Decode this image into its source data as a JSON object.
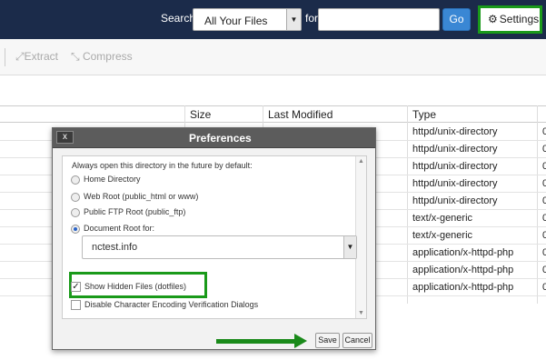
{
  "topbar": {
    "search_label": "Search",
    "search_scope": "All Your Files",
    "for_label": "for",
    "search_value": "",
    "go_label": "Go",
    "settings_label": "Settings"
  },
  "toolbar": {
    "extract_label": "Extract",
    "compress_label": "Compress"
  },
  "table": {
    "headers": {
      "size": "Size",
      "last_modified": "Last Modified",
      "type": "Type"
    },
    "rows": [
      {
        "type": "httpd/unix-directory",
        "perm": "0"
      },
      {
        "type": "httpd/unix-directory",
        "perm": "0"
      },
      {
        "type": "httpd/unix-directory",
        "perm": "0"
      },
      {
        "type": "httpd/unix-directory",
        "perm": "0"
      },
      {
        "type": "httpd/unix-directory",
        "perm": "0"
      },
      {
        "type": "text/x-generic",
        "perm": "0"
      },
      {
        "type": "text/x-generic",
        "perm": "0"
      },
      {
        "type": "application/x-httpd-php",
        "perm": "0"
      },
      {
        "type": "application/x-httpd-php",
        "perm": "0"
      },
      {
        "type": "application/x-httpd-php",
        "perm": "0"
      }
    ]
  },
  "dialog": {
    "title": "Preferences",
    "close_label": "x",
    "intro": "Always open this directory in the future by default:",
    "options": [
      {
        "label": "Home Directory",
        "checked": false
      },
      {
        "label": "Web Root (public_html or www)",
        "checked": false
      },
      {
        "label": "Public FTP Root (public_ftp)",
        "checked": false
      },
      {
        "label": "Document Root for:",
        "checked": true
      }
    ],
    "document_root_value": "nctest.info",
    "show_hidden_label": "Show Hidden Files (dotfiles)",
    "show_hidden_checked": true,
    "disable_encoding_label": "Disable Character Encoding Verification Dialogs",
    "disable_encoding_checked": false,
    "save_label": "Save",
    "cancel_label": "Cancel"
  },
  "colors": {
    "topbar_bg": "#1b2b4a",
    "highlight_green": "#1a9a1a",
    "go_blue": "#3a87d4",
    "dialog_title_bg": "#5c5c5c"
  }
}
